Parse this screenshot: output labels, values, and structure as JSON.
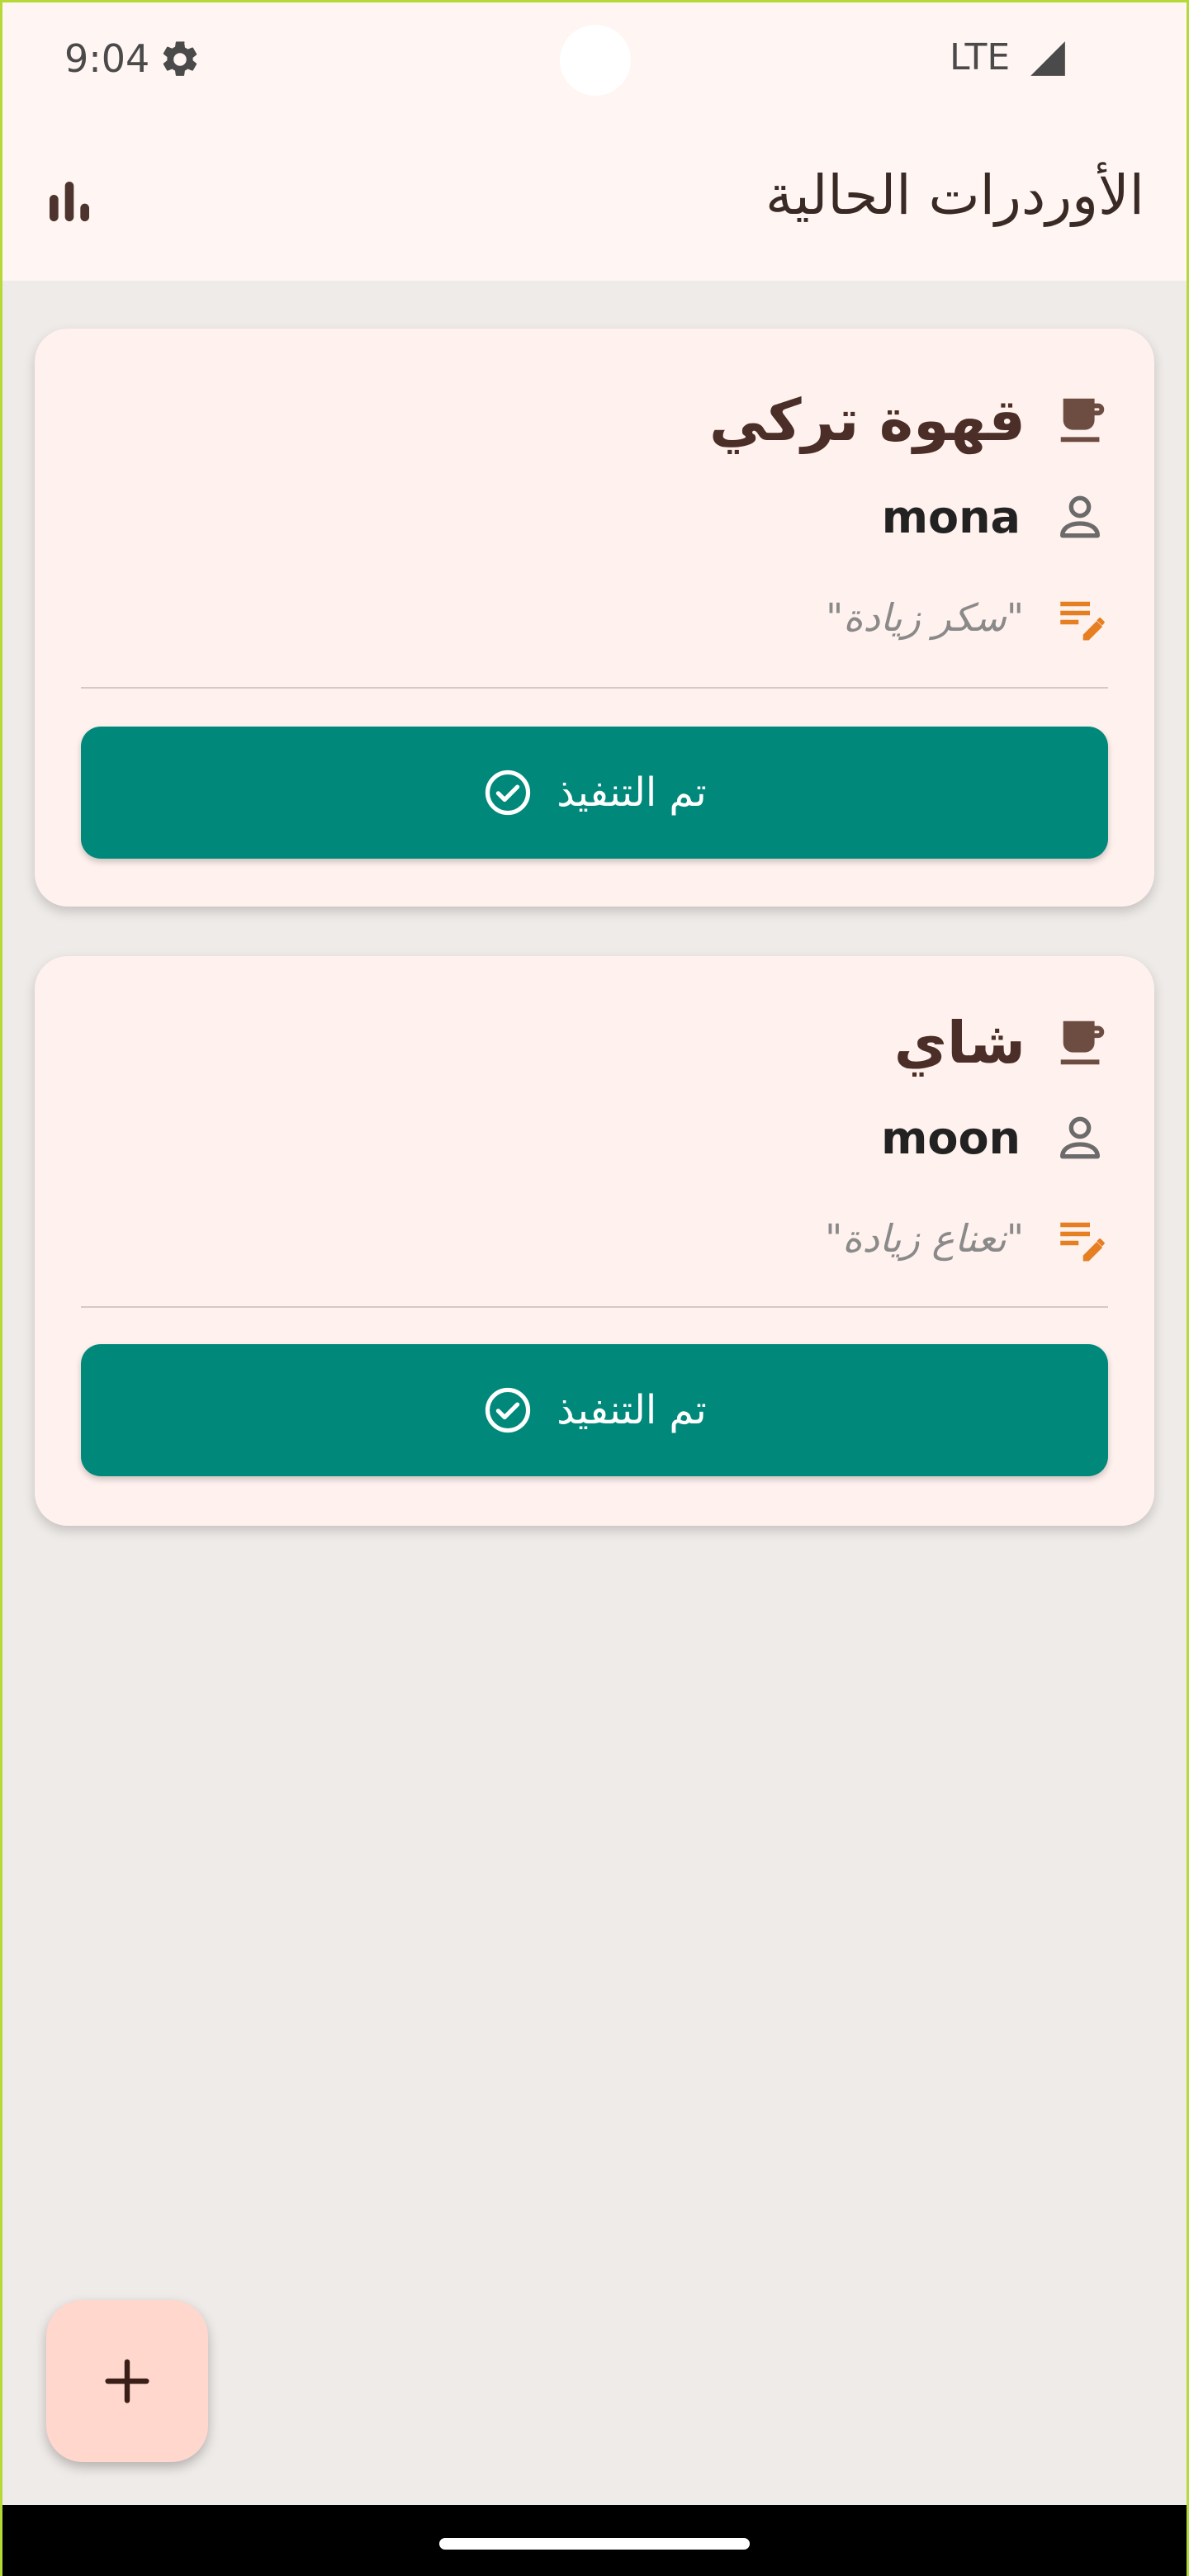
{
  "status_bar": {
    "time": "9:04",
    "network": "LTE",
    "settings_icon": "gear-icon",
    "signal_icon": "signal-icon"
  },
  "app_bar": {
    "title": "الأوردرات الحالية",
    "stats_icon": "bar-chart-icon"
  },
  "orders": [
    {
      "drink": "قهوة تركي",
      "customer": "mona",
      "note": "\"سكر زيادة\"",
      "action_label": "تم التنفيذ"
    },
    {
      "drink": "شاي",
      "customer": "moon",
      "note": "\"نعناع زيادة\"",
      "action_label": "تم التنفيذ"
    }
  ],
  "fab": {
    "label": "+",
    "icon": "add-icon"
  },
  "colors": {
    "primary": "#00897B",
    "accent": "#E67E22",
    "drink_icon": "#6D4C41",
    "card_bg": "#FFF1ED",
    "fab_bg": "#FFD7CC"
  }
}
